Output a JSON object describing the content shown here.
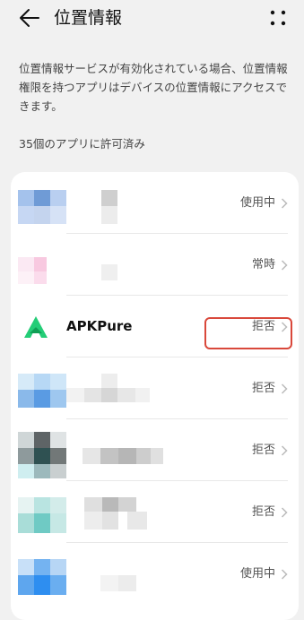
{
  "header": {
    "title": "位置情報"
  },
  "description": "位置情報サービスが有効化されている場合、位置情報権限を持つアプリはデバイスの位置情報にアクセスできます。",
  "allowed_count": "35個のアプリに許可済み",
  "apps": [
    {
      "name": "",
      "status": "使用中"
    },
    {
      "name": "",
      "status": "常時"
    },
    {
      "name": "APKPure",
      "status": "拒否"
    },
    {
      "name": "",
      "status": "拒否"
    },
    {
      "name": "",
      "status": "拒否"
    },
    {
      "name": "",
      "status": "拒否"
    },
    {
      "name": "",
      "status": "使用中"
    }
  ],
  "colors": {
    "background": "#f1f1f1",
    "card": "#ffffff",
    "highlight": "#d9483b",
    "apkpure_green": "#24cd77"
  },
  "icons": {
    "back": "arrow-left-icon",
    "more": "more-dots-icon",
    "chevron": "chevron-right-icon",
    "apkpure": "apkpure-logo-icon"
  }
}
